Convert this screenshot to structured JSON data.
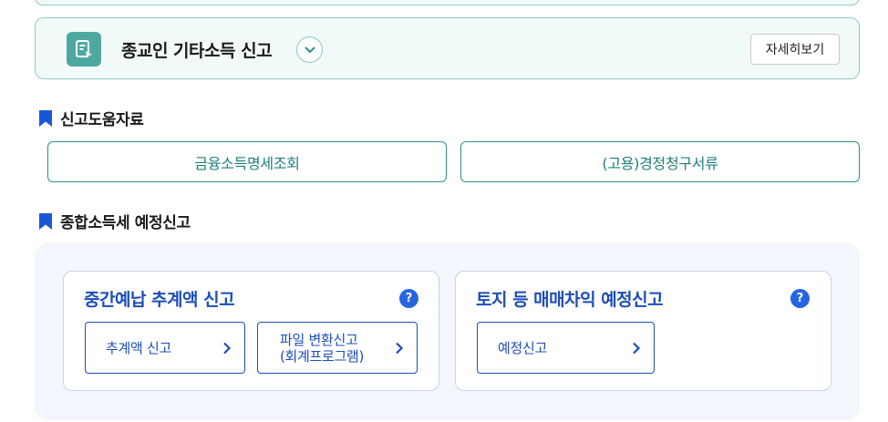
{
  "religious_income": {
    "title": "종교인 기타소득 신고",
    "detail_label": "자세히보기",
    "icon": "document-edit-icon"
  },
  "help_materials": {
    "heading": "신고도움자료",
    "buttons": [
      {
        "label": "금융소득명세조회"
      },
      {
        "label": "(고용)경정청구서류"
      }
    ]
  },
  "comprehensive_prelim": {
    "heading": "종합소득세 예정신고",
    "cards": [
      {
        "title": "중간예납 추계액 신고",
        "help_icon": "?",
        "actions": [
          {
            "label": "추계액 신고"
          },
          {
            "label_line1": "파일 변환신고",
            "label_line2": "(회계프로그램)"
          }
        ]
      },
      {
        "title": "토지 등 매매차익 예정신고",
        "help_icon": "?",
        "actions": [
          {
            "label": "예정신고"
          }
        ]
      }
    ]
  },
  "colors": {
    "teal_accent": "#2e8f88",
    "blue_accent": "#1d4db8",
    "help_blue": "#2566e0",
    "panel_bg": "#f3f6fc"
  }
}
